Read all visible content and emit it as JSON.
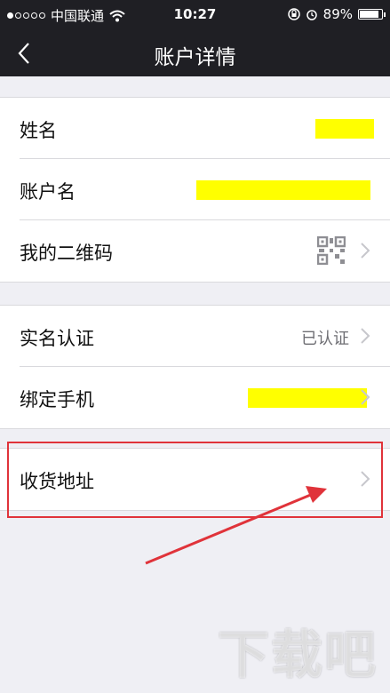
{
  "status_bar": {
    "carrier": "中国联通",
    "time": "10:27",
    "battery": "89%",
    "battery_level": 0.89
  },
  "nav": {
    "title": "账户详情",
    "back_icon": "chevron-left-icon"
  },
  "groups": [
    {
      "rows": [
        {
          "label": "姓名"
        },
        {
          "label": "账户名"
        },
        {
          "label": "我的二维码",
          "icon": "qr-code-icon"
        }
      ]
    },
    {
      "rows": [
        {
          "label": "实名认证",
          "value": "已认证"
        },
        {
          "label": "绑定手机"
        }
      ]
    },
    {
      "rows": [
        {
          "label": "收货地址"
        }
      ]
    }
  ],
  "annotation": {
    "highlight_color": "#e0333a"
  },
  "watermark": "下载吧"
}
